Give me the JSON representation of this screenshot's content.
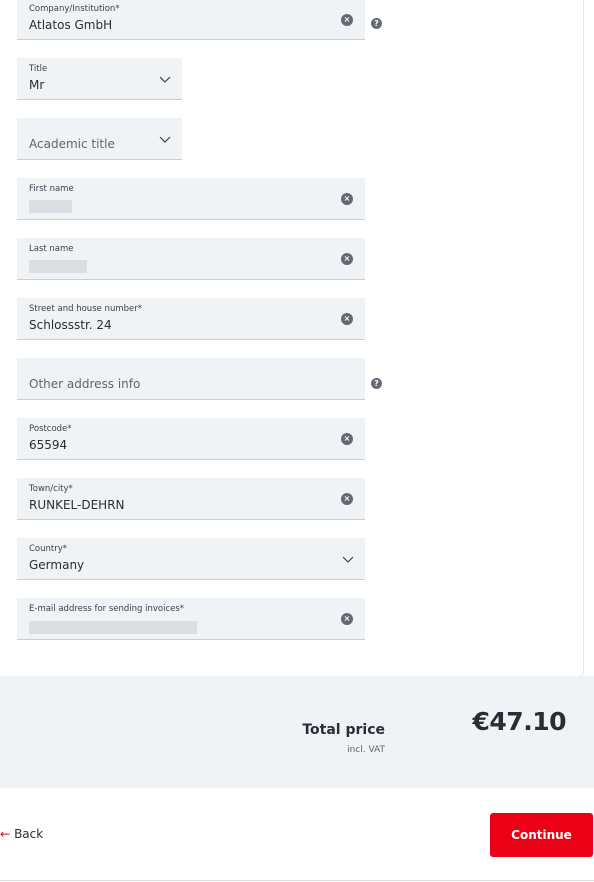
{
  "form": {
    "company": {
      "label": "Company/Institution*",
      "value": "Atlatos GmbH"
    },
    "title": {
      "label": "Title",
      "value": "Mr"
    },
    "academic_title": {
      "placeholder": "Academic title"
    },
    "first_name": {
      "label": "First name"
    },
    "last_name": {
      "label": "Last name"
    },
    "street": {
      "label": "Street and house number*",
      "value": "Schlossstr. 24"
    },
    "other_address": {
      "placeholder": "Other address info"
    },
    "postcode": {
      "label": "Postcode*",
      "value": "65594"
    },
    "town": {
      "label": "Town/city*",
      "value": "RUNKEL-DEHRN"
    },
    "country": {
      "label": "Country*",
      "value": "Germany"
    },
    "email": {
      "label": "E-mail address for sending invoices*"
    }
  },
  "icons": {
    "clear": "clear-icon",
    "help": "help-icon",
    "chevron": "chevron-down-icon",
    "back_arrow": "arrow-left-icon"
  },
  "glyphs": {
    "clear": "×",
    "help": "?",
    "back_arrow": "←"
  },
  "summary": {
    "total_label": "Total price",
    "vat_label": "incl. VAT",
    "price": "€47.10"
  },
  "footer": {
    "back_label": "Back",
    "continue_label": "Continue"
  },
  "colors": {
    "accent": "#ec0016",
    "field_bg": "#f0f3f5",
    "summary_bg": "#f0f3f5"
  }
}
